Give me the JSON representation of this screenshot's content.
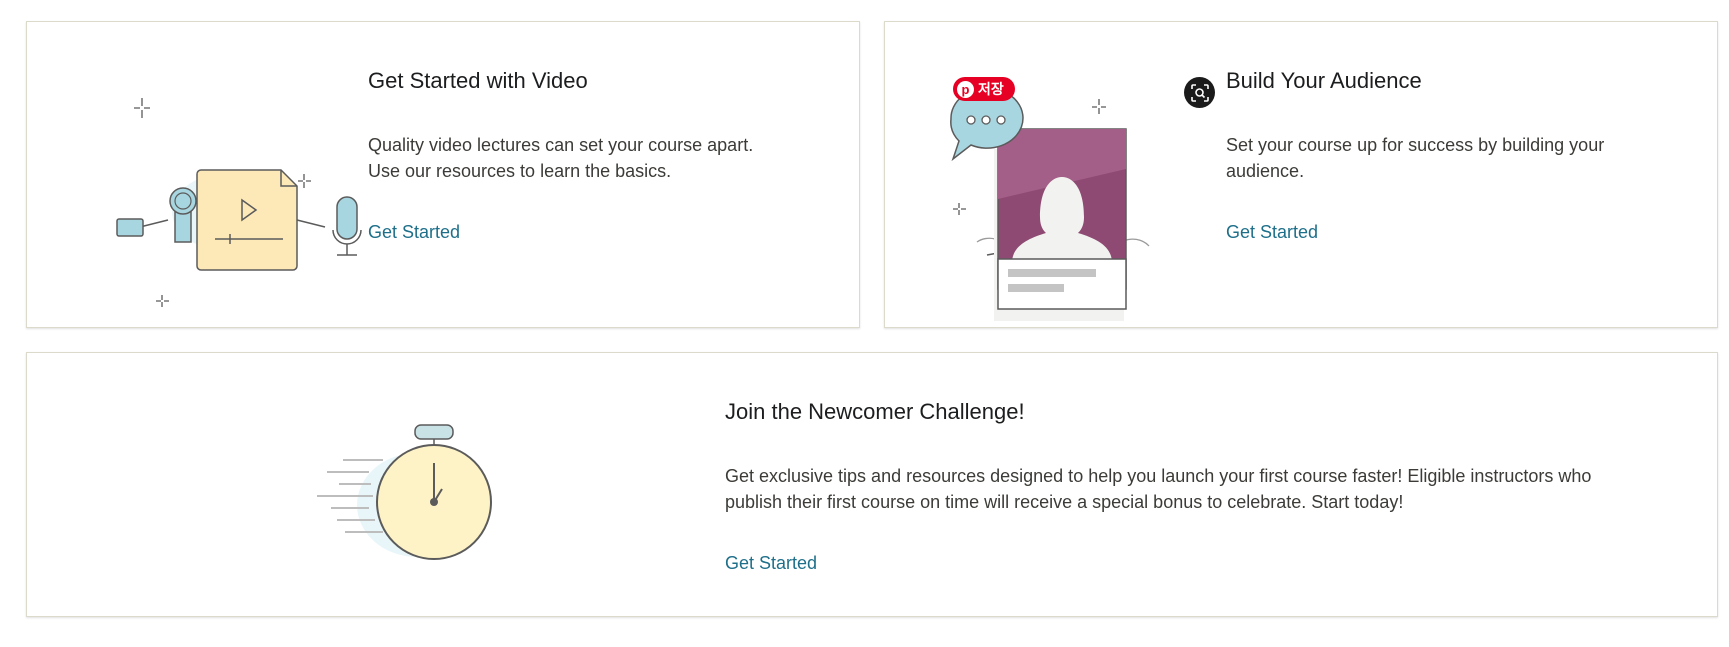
{
  "cards": [
    {
      "title": "Get Started with Video",
      "description_lines": [
        "Quality video lectures can set your course apart.",
        "Use our resources to learn the basics."
      ],
      "link": "Get Started"
    },
    {
      "title": "Build Your Audience",
      "description_lines": [
        "Set your course up for success by building your",
        "audience."
      ],
      "link": "Get Started"
    },
    {
      "title": "Join the Newcomer Challenge!",
      "description_lines": [
        "Get exclusive tips and resources designed to help you launch your first course faster! Eligible instructors who",
        "publish their first course on time will receive a special bonus to celebrate. Start today!"
      ],
      "link": "Get Started"
    }
  ],
  "overlay": {
    "pin_button_label": "저장",
    "pin_logo": "p",
    "lens_icon": "visual-search-icon"
  },
  "colors": {
    "link": "#1e6f8a",
    "pin_red": "#e60023",
    "video_yellow": "#fde9b8",
    "accent_blue": "#a8d6e0",
    "profile_purple": "#8e4a73"
  }
}
